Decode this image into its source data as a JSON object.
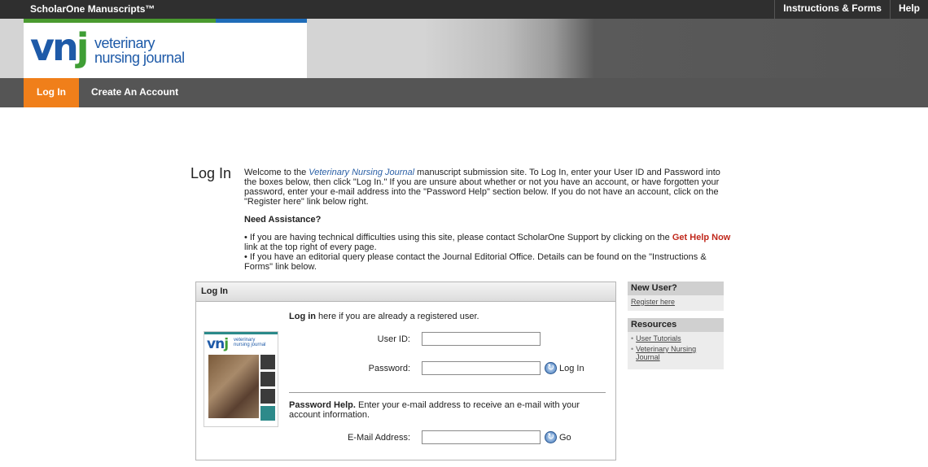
{
  "topbar": {
    "brand": "ScholarOne Manuscripts™",
    "links": [
      "Instructions & Forms",
      "Help"
    ]
  },
  "logo": {
    "mark_v": "v",
    "mark_n": "n",
    "mark_j": "j",
    "line1": "veterinary",
    "line2": "nursing journal"
  },
  "nav": {
    "login": "Log In",
    "create": "Create An Account"
  },
  "page": {
    "title": "Log In",
    "intro_pre": "Welcome to the ",
    "intro_journal": "Veterinary Nursing Journal",
    "intro_post": " manuscript submission site. To Log In, enter your User ID and Password into the boxes below, then click \"Log In.\" If you are unsure about whether or not you have an account, or have forgotten your password, enter your e-mail address into the \"Password Help\" section below. If you do not have an account, click on the \"Register here\" link below right.",
    "assist_heading": "Need Assistance?",
    "bullet1_pre": "If you are having technical difficulties using this site, please contact ScholarOne Support by clicking on the ",
    "bullet1_link": "Get Help Now",
    "bullet1_post": " link at the top right of every page.",
    "bullet2": "If you have an editorial query please contact the Journal Editorial Office. Details can be found on the \"Instructions & Forms\" link below."
  },
  "login_panel": {
    "heading": "Log In",
    "intro_bold": "Log in",
    "intro_rest": " here if you are already a registered user.",
    "userid_label": "User ID:",
    "userid_value": "",
    "password_label": "Password:",
    "password_value": "",
    "login_btn": "Log In",
    "pw_help_bold": "Password Help.",
    "pw_help_rest": " Enter your e-mail address to receive an e-mail with your account information.",
    "email_label": "E-Mail Address:",
    "email_value": "",
    "go_btn": "Go",
    "cover": {
      "mark": "vn",
      "mark_j": "j",
      "title1": "veterinary",
      "title2": "nursing journal"
    }
  },
  "sidebar": {
    "new_user_head": "New User?",
    "register_link": "Register here",
    "resources_head": "Resources",
    "resources": [
      "User Tutorials",
      "Veterinary Nursing Journal"
    ]
  }
}
